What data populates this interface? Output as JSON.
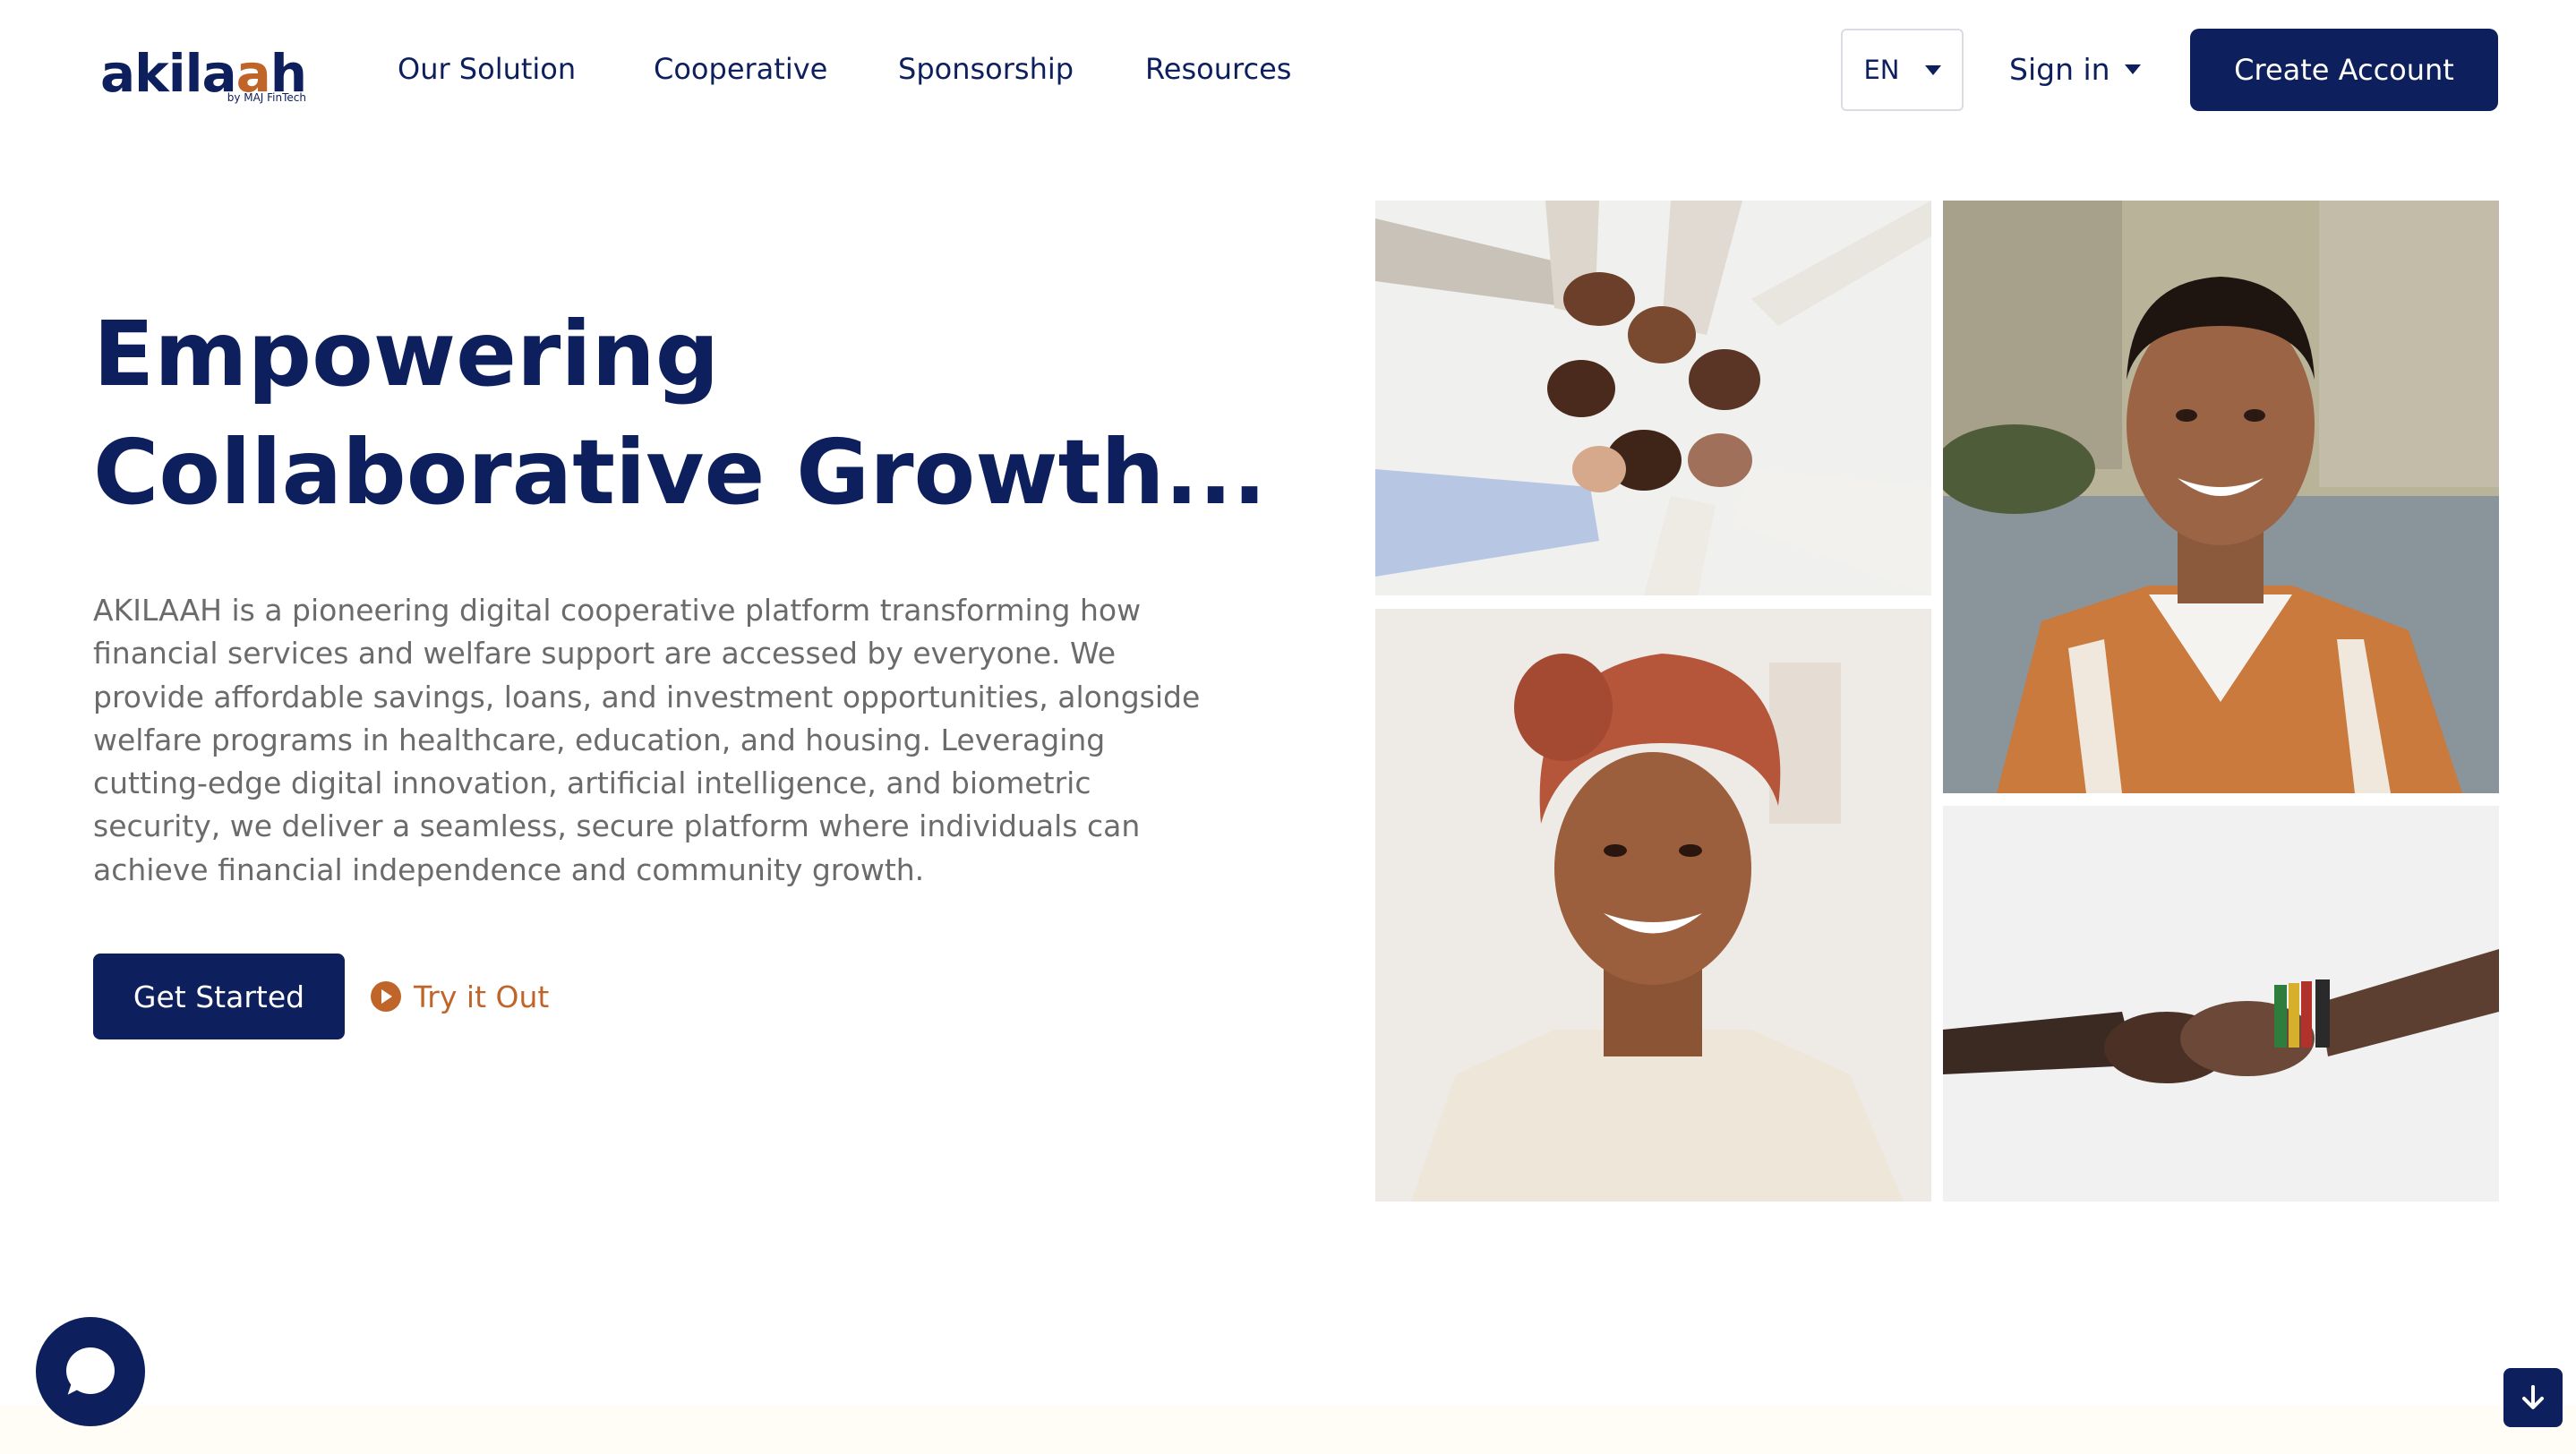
{
  "header": {
    "logo": {
      "word_main": "akila",
      "word_accent": "a",
      "word_end": "h",
      "tagline": "by MAJ FinTech"
    },
    "nav": [
      "Our Solution",
      "Cooperative",
      "Sponsorship",
      "Resources"
    ],
    "language": "EN",
    "signin_label": "Sign in",
    "create_account_label": "Create Account"
  },
  "hero": {
    "title_line1": "Empowering",
    "title_line2": "Collaborative Growth...",
    "description": "AKILAAH is a pioneering digital cooperative platform transforming how financial services and welfare support are accessed by everyone. We provide affordable savings, loans, and investment opportunities, alongside welfare programs in healthcare, education, and housing. Leveraging cutting-edge digital innovation, artificial intelligence, and biometric security, we deliver a seamless, secure platform where individuals can achieve financial independence and community growth.",
    "get_started_label": "Get Started",
    "try_label": "Try it Out"
  },
  "photos": [
    "joined-hands-photo",
    "smiling-man-photo",
    "smiling-woman-photo",
    "handshake-photo"
  ],
  "colors": {
    "brand_navy": "#0d1f5c",
    "accent_orange": "#c0652a",
    "body_text": "#6b6b6b"
  }
}
